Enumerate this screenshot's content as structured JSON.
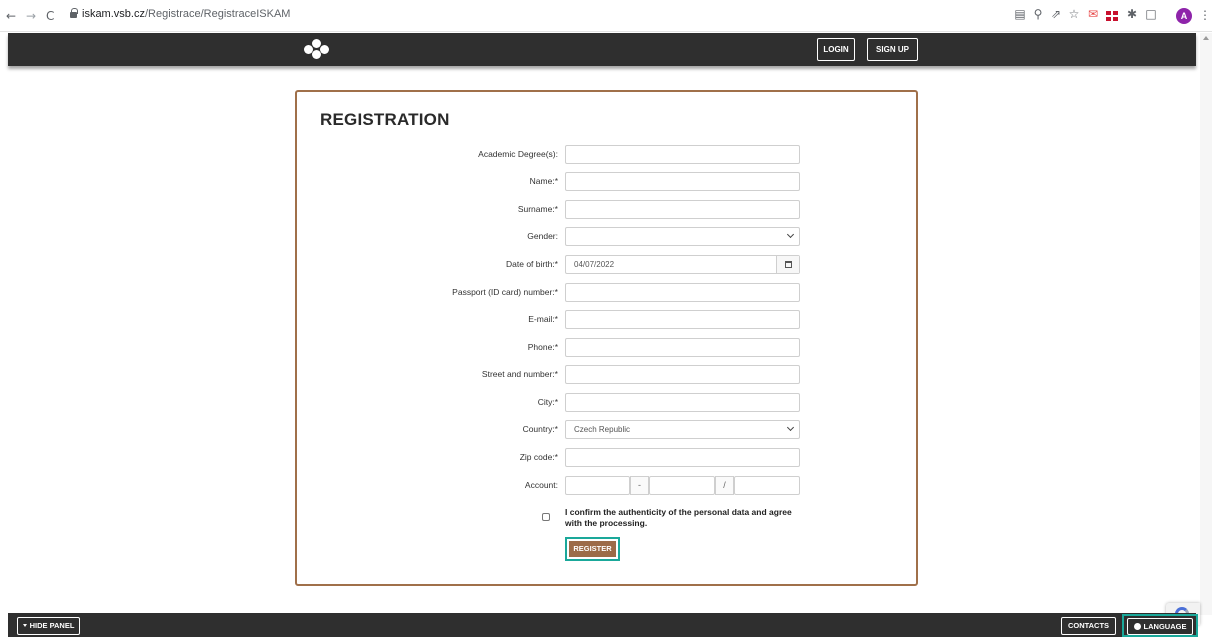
{
  "browser": {
    "nav": {
      "back": "←",
      "forward": "→",
      "reload": "C"
    },
    "url_host": "iskam.vsb.cz",
    "url_path": "/Registrace/RegistraceISKAM",
    "ext_icons": [
      "translate-icon",
      "zoom-icon",
      "share-icon",
      "star-icon",
      "mail-icon",
      "uk-flag-icon",
      "puzzle-icon",
      "sidebar-icon"
    ],
    "avatar": "A",
    "menu": "⋮"
  },
  "header": {
    "login_label": "LOGIN",
    "signup_label": "SIGN UP"
  },
  "form": {
    "title": "REGISTRATION",
    "fields": {
      "degree": {
        "label": "Academic Degree(s):",
        "value": ""
      },
      "name": {
        "label": "Name:*",
        "value": ""
      },
      "surname": {
        "label": "Surname:*",
        "value": ""
      },
      "gender": {
        "label": "Gender:",
        "value": ""
      },
      "dob": {
        "label": "Date of birth:*",
        "value": "04/07/2022"
      },
      "passport": {
        "label": "Passport (ID card) number:*",
        "value": ""
      },
      "email": {
        "label": "E-mail:*",
        "value": ""
      },
      "phone": {
        "label": "Phone:*",
        "value": ""
      },
      "street": {
        "label": "Street and number:*",
        "value": ""
      },
      "city": {
        "label": "City:*",
        "value": ""
      },
      "country": {
        "label": "Country:*",
        "value": "Czech Republic"
      },
      "zip": {
        "label": "Zip code:*",
        "value": ""
      },
      "account": {
        "label": "Account:",
        "sep1": "-",
        "sep2": "/"
      }
    },
    "confirm_text": "I confirm the authenticity of the personal data and agree with the processing.",
    "register_label": "REGISTER"
  },
  "footer": {
    "hide_panel_label": "HIDE PANEL",
    "contacts_label": "CONTACTS",
    "language_label": "LANGUAGE"
  },
  "colors": {
    "header_bg": "#2f2f2f",
    "card_border": "#a0704a",
    "register_bg": "#9c6b48",
    "focus_outline": "#1aa89a",
    "avatar": "#8e24aa"
  }
}
